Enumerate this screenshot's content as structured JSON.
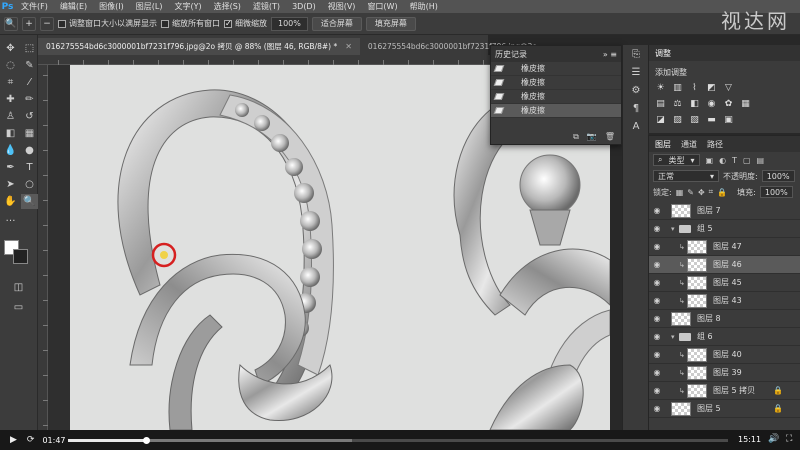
{
  "app": {
    "logo": "Ps"
  },
  "menu": [
    "文件(F)",
    "编辑(E)",
    "图像(I)",
    "图层(L)",
    "文字(Y)",
    "选择(S)",
    "滤镜(T)",
    "3D(D)",
    "视图(V)",
    "窗口(W)",
    "帮助(H)"
  ],
  "options_bar": {
    "zoom_in_icon": "zoom-in-icon",
    "zoom_out_icon": "zoom-out-icon",
    "resize_windows_label": "调整窗口大小以满屏显示",
    "resize_windows_checked": false,
    "zoom_all_label": "缩放所有窗口",
    "zoom_all_checked": false,
    "scrubby_zoom_label": "细微缩放",
    "scrubby_zoom_checked": true,
    "zoom_value": "100%",
    "fit_screen": "适合屏幕",
    "fill_screen": "填充屏幕"
  },
  "watermark": "视达网",
  "doc_tabs": [
    {
      "label": "016275554bd6c3000001bf7231f796.jpg@2o 拷贝 @ 88% (图层 46, RGB/8#) *",
      "active": true
    },
    {
      "label": "016275554bd6c3000001bf7231f796.jpg@2o...",
      "active": false
    }
  ],
  "history": {
    "title": "历史记录",
    "items": [
      "橡皮擦",
      "橡皮擦",
      "橡皮擦",
      "橡皮擦"
    ],
    "selected_index": 3
  },
  "adjustments": {
    "tabs": [
      "调整"
    ],
    "add_label": "添加调整"
  },
  "layers": {
    "tabs": [
      "图层",
      "通道",
      "路径"
    ],
    "filter_kind": "类型",
    "blend_mode": "正常",
    "opacity_label": "不透明度:",
    "opacity_value": "100%",
    "lock_label": "锁定:",
    "fill_label": "填充:",
    "fill_value": "100%",
    "rows": [
      {
        "name": "图层 7",
        "type": "layer",
        "indent": 1,
        "selected": false,
        "locked": false
      },
      {
        "name": "组 5",
        "type": "group",
        "indent": 1,
        "selected": false,
        "locked": false
      },
      {
        "name": "图层 47",
        "type": "layer",
        "indent": 2,
        "selected": false,
        "locked": false
      },
      {
        "name": "图层 46",
        "type": "layer",
        "indent": 2,
        "selected": true,
        "locked": false
      },
      {
        "name": "图层 45",
        "type": "layer",
        "indent": 2,
        "selected": false,
        "locked": false
      },
      {
        "name": "图层 43",
        "type": "layer",
        "indent": 2,
        "selected": false,
        "locked": false
      },
      {
        "name": "图层 8",
        "type": "layer",
        "indent": 1,
        "selected": false,
        "locked": false
      },
      {
        "name": "组 6",
        "type": "group",
        "indent": 1,
        "selected": false,
        "locked": false
      },
      {
        "name": "图层 40",
        "type": "layer",
        "indent": 2,
        "selected": false,
        "locked": false
      },
      {
        "name": "图层 39",
        "type": "layer",
        "indent": 2,
        "selected": false,
        "locked": false
      },
      {
        "name": "图层 5 拷贝",
        "type": "layer",
        "indent": 2,
        "selected": false,
        "locked": true
      },
      {
        "name": "图层 5",
        "type": "layer",
        "indent": 1,
        "selected": false,
        "locked": true
      }
    ]
  },
  "player": {
    "current_time": "01:47",
    "total_time": "15:11",
    "progress_fraction": 0.118,
    "buffered_fraction": 0.43
  }
}
